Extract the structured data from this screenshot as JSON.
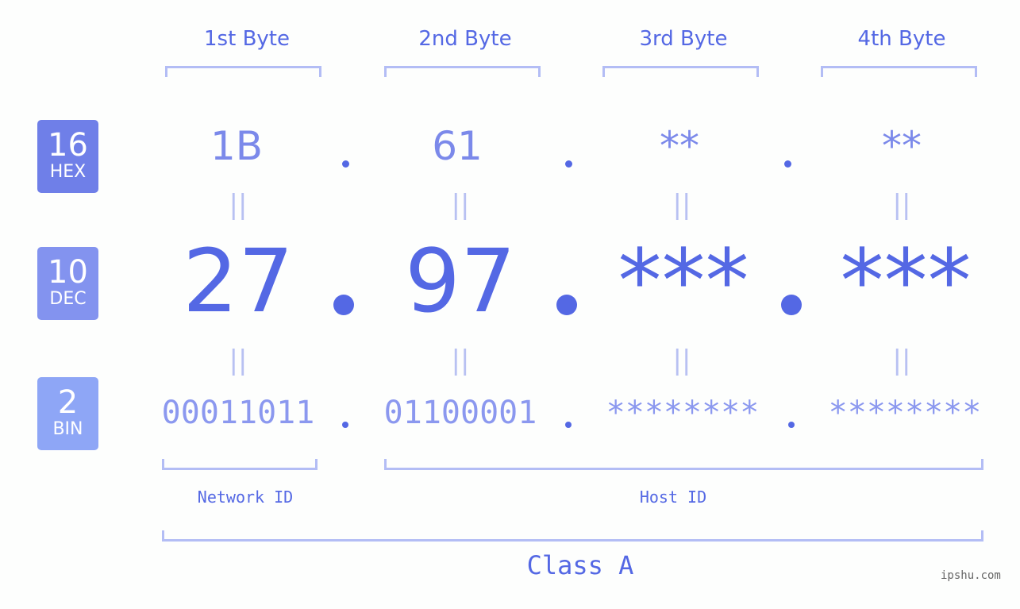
{
  "bytes": [
    {
      "label": "1st Byte",
      "hex": "1B",
      "dec": "27",
      "bin": "00011011"
    },
    {
      "label": "2nd Byte",
      "hex": "61",
      "dec": "97",
      "bin": "01100001"
    },
    {
      "label": "3rd Byte",
      "hex": "**",
      "dec": "***",
      "bin": "********"
    },
    {
      "label": "4th Byte",
      "hex": "**",
      "dec": "***",
      "bin": "********"
    }
  ],
  "badges": {
    "hex": {
      "num": "16",
      "label": "HEX",
      "color": "#6f7fe8"
    },
    "dec": {
      "num": "10",
      "label": "DEC",
      "color": "#8393ef"
    },
    "bin": {
      "num": "2",
      "label": "BIN",
      "color": "#8ea6f6"
    }
  },
  "equals_symbol": "||",
  "network_label": "Network ID",
  "host_label": "Host ID",
  "class_label": "Class A",
  "watermark": "ipshu.com"
}
